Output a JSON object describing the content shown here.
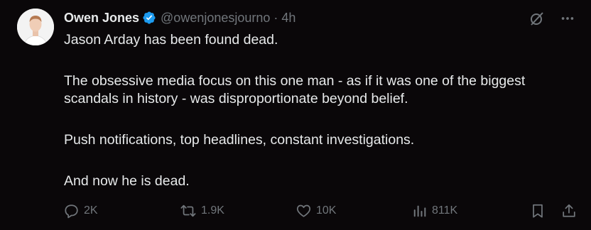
{
  "author": {
    "name": "Owen Jones",
    "handle": "@owenjonesjourno",
    "time": "4h",
    "separator": "·"
  },
  "tweet": {
    "paragraphs": [
      "Jason Arday has been found dead.",
      "The obsessive media focus on this one man - as if it was one of the biggest scandals in history - was disproportionate beyond belief.",
      "Push notifications, top headlines, constant investigations.",
      "And now he is dead."
    ]
  },
  "metrics": {
    "replies": "2K",
    "reposts": "1.9K",
    "likes": "10K",
    "views": "811K"
  },
  "icons": {
    "verified": "verified-badge-icon",
    "grok": "grok-icon",
    "more": "more-icon",
    "reply": "reply-icon",
    "repost": "repost-icon",
    "like": "heart-icon",
    "views": "views-icon",
    "bookmark": "bookmark-icon",
    "share": "share-icon"
  },
  "colors": {
    "background": "#0a0709",
    "text": "#e7e9ea",
    "muted": "#71767b",
    "verified": "#1d9bf0"
  }
}
